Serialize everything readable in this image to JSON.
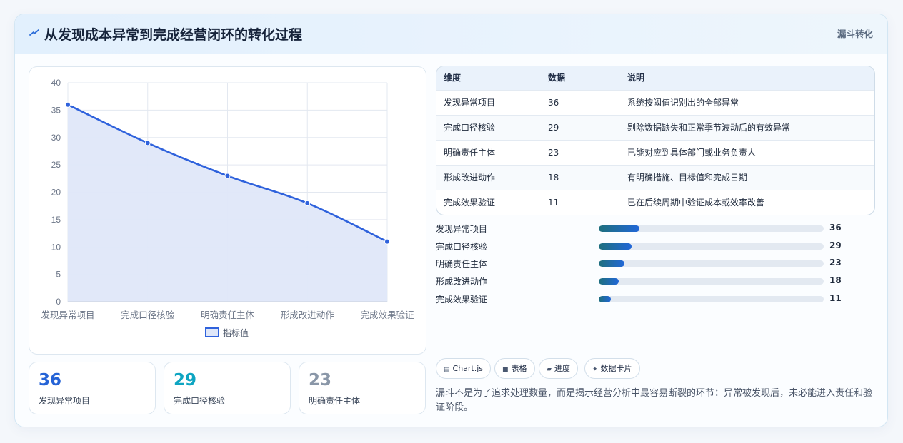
{
  "header": {
    "title": "从发现成本异常到完成经营闭环的转化过程",
    "tag": "漏斗转化",
    "icon": "bolt-icon"
  },
  "chart_data": {
    "type": "line",
    "categories": [
      "发现异常项目",
      "完成口径核验",
      "明确责任主体",
      "形成改进动作",
      "完成效果验证"
    ],
    "series": [
      {
        "name": "指标值",
        "values": [
          36,
          29,
          23,
          18,
          11
        ]
      }
    ],
    "ylim": [
      0,
      40
    ],
    "yticks": [
      0,
      5,
      10,
      15,
      20,
      25,
      30,
      35,
      40
    ],
    "grid": true,
    "fill": true,
    "legend_position": "bottom",
    "colors": {
      "line": "#2f62dc",
      "fill": "#dfe7f9",
      "grid": "#e3e8f0",
      "axis_text": "#6b7587"
    }
  },
  "kpis": [
    {
      "value": "36",
      "label": "发现异常项目",
      "color": "#2563d6"
    },
    {
      "value": "29",
      "label": "完成口径核验",
      "color": "#0ea5c2"
    },
    {
      "value": "23",
      "label": "明确责任主体",
      "color": "#8a97a8"
    }
  ],
  "table": {
    "headers": [
      "维度",
      "数据",
      "说明"
    ],
    "rows": [
      [
        "发现异常项目",
        "36",
        "系统按阈值识别出的全部异常"
      ],
      [
        "完成口径核验",
        "29",
        "剔除数据缺失和正常季节波动后的有效异常"
      ],
      [
        "明确责任主体",
        "23",
        "已能对应到具体部门或业务负责人"
      ],
      [
        "形成改进动作",
        "18",
        "有明确措施、目标值和完成日期"
      ],
      [
        "完成效果验证",
        "11",
        "已在后续周期中验证成本或效率改善"
      ]
    ]
  },
  "progress": {
    "max": 200,
    "items": [
      {
        "label": "发现异常项目",
        "value": 36
      },
      {
        "label": "完成口径核验",
        "value": 29
      },
      {
        "label": "明确责任主体",
        "value": 23
      },
      {
        "label": "形成改进动作",
        "value": 18
      },
      {
        "label": "完成效果验证",
        "value": 11
      }
    ]
  },
  "chips": [
    {
      "icon": "▤",
      "icon_name": "chart-icon",
      "label": "Chart.js"
    },
    {
      "icon": "■",
      "icon_name": "table-icon",
      "label": "表格"
    },
    {
      "icon": "▰",
      "icon_name": "progress-icon",
      "label": "进度"
    },
    {
      "icon": "✦",
      "icon_name": "sparkle-icon",
      "label": "数据卡片"
    }
  ],
  "note": "漏斗不是为了追求处理数量，而是揭示经营分析中最容易断裂的环节：异常被发现后，未必能进入责任和验证阶段。"
}
